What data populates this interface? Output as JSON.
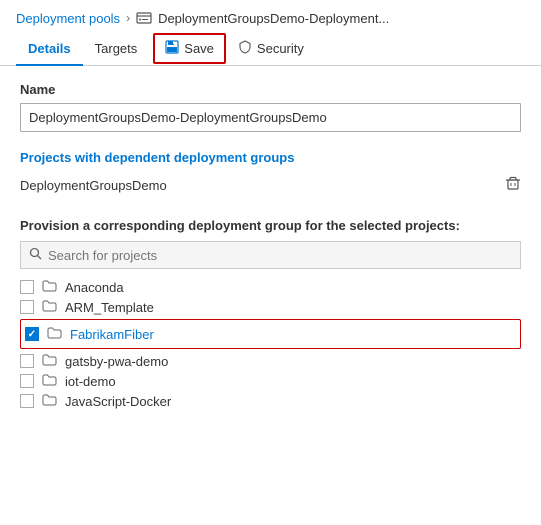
{
  "breadcrumb": {
    "link_label": "Deployment pools",
    "separator": "›",
    "icon_label": "deployment-group-icon",
    "current": "DeploymentGroupsDemo-Deployment..."
  },
  "tabs": [
    {
      "id": "details",
      "label": "Details",
      "active": true
    },
    {
      "id": "targets",
      "label": "Targets",
      "active": false
    }
  ],
  "save_button": {
    "label": "Save",
    "icon": "💾"
  },
  "security_tab": {
    "label": "Security",
    "icon": "🛡"
  },
  "form": {
    "name_label": "Name",
    "name_value": "DeploymentGroupsDemo-DeploymentGroupsDemo",
    "projects_section_title": "Projects with dependent deployment groups",
    "dependent_project": "DeploymentGroupsDemo",
    "provision_label": "Provision a corresponding deployment group for the selected projects:",
    "search_placeholder": "Search for projects"
  },
  "projects": [
    {
      "id": "anaconda",
      "name": "Anaconda",
      "checked": false,
      "highlighted": false,
      "selected_row": false
    },
    {
      "id": "arm-template",
      "name": "ARM_Template",
      "checked": false,
      "highlighted": false,
      "selected_row": false
    },
    {
      "id": "fabrikamfiber",
      "name": "FabrikamFiber",
      "checked": true,
      "highlighted": true,
      "selected_row": true
    },
    {
      "id": "gatsby-pwa-demo",
      "name": "gatsby-pwa-demo",
      "checked": false,
      "highlighted": false,
      "selected_row": false
    },
    {
      "id": "iot-demo",
      "name": "iot-demo",
      "checked": false,
      "highlighted": false,
      "selected_row": false
    },
    {
      "id": "javascript-docker",
      "name": "JavaScript-Docker",
      "checked": false,
      "highlighted": false,
      "selected_row": false
    }
  ]
}
